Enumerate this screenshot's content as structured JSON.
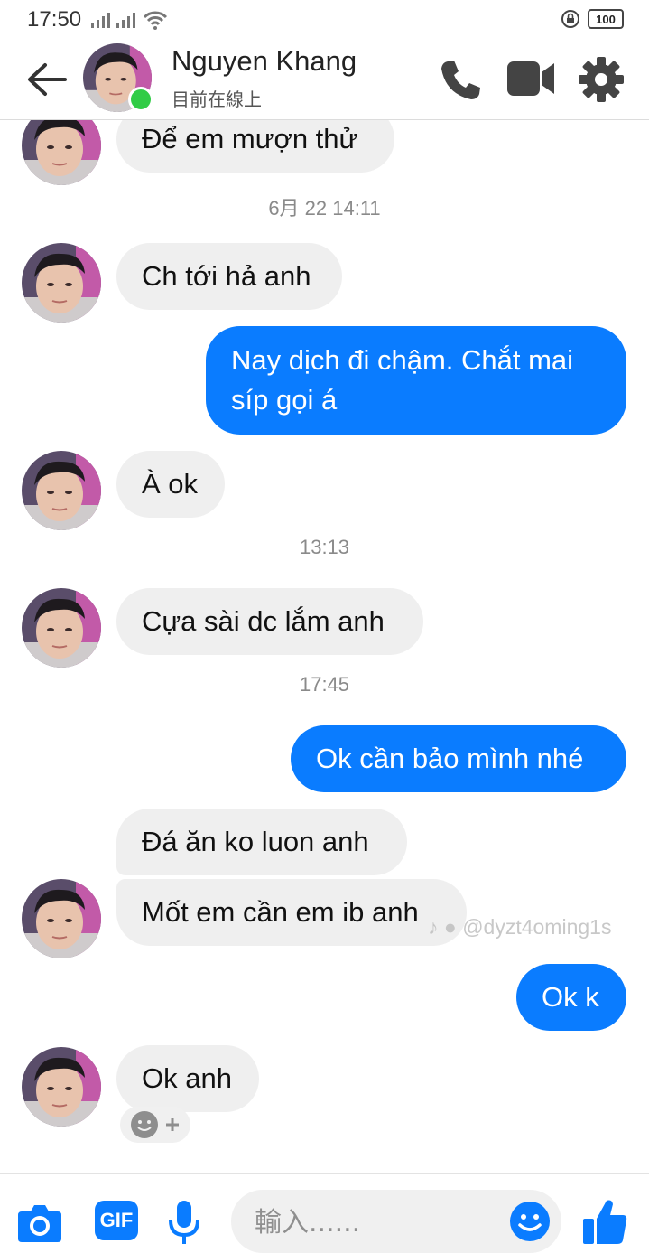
{
  "status_bar": {
    "time": "17:50",
    "battery": "100"
  },
  "header": {
    "name": "Nguyen Khang",
    "status": "目前在線上"
  },
  "messages": [
    {
      "side": "in",
      "text": "Để em mượn thử"
    },
    {
      "side": "ts",
      "text": "6月 22 14:11"
    },
    {
      "side": "in",
      "text": "Ch tới hả anh"
    },
    {
      "side": "out",
      "text": "Nay dịch đi chậm. Chắt mai síp gọi á"
    },
    {
      "side": "in",
      "text": "À ok"
    },
    {
      "side": "ts",
      "text": "13:13"
    },
    {
      "side": "in",
      "text": "Cựa sài dc lắm anh"
    },
    {
      "side": "ts",
      "text": "17:45"
    },
    {
      "side": "out",
      "text": "Ok cần bảo mình nhé"
    },
    {
      "side": "in",
      "text": "Đá ăn ko luon anh"
    },
    {
      "side": "in",
      "text": "Mốt em cần em ib anh"
    },
    {
      "side": "out",
      "text": "Ok k"
    },
    {
      "side": "in",
      "text": "Ok anh"
    }
  ],
  "watermark": "@dyzt4oming1s",
  "composer": {
    "placeholder": "輸入......",
    "gif_label": "GIF"
  },
  "colors": {
    "accent": "#0a7cff",
    "incoming_bubble": "#efefef",
    "online": "#31cc46"
  }
}
